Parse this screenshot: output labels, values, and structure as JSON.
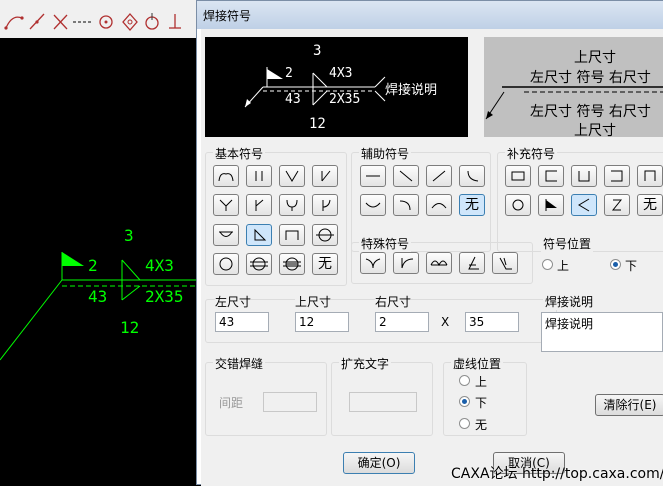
{
  "cad": {
    "toolbar_icons": [
      "arc-tool-icon",
      "line-tool-icon",
      "cross-tool-icon",
      "dash-line-icon",
      "circle-tool-icon",
      "polygon-tool-icon",
      "rotate-tool-icon",
      "anchor-tool-icon"
    ],
    "symbol": {
      "top": "3",
      "left": "43",
      "upper_left": "2",
      "upper_right": "4X3",
      "lower_right": "2X35",
      "bottom": "12"
    }
  },
  "dialog": {
    "title": "焊接符号",
    "preview": {
      "top": "3",
      "upper_left": "2",
      "upper_right": "4X3",
      "lower_left": "43",
      "lower_right": "2X35",
      "bottom": "12",
      "note": "焊接说明"
    },
    "legend": {
      "top": "上尺寸",
      "row1": "左尺寸 符号 右尺寸",
      "row2": "左尺寸 符号 右尺寸",
      "bottom": "上尺寸"
    },
    "groups": {
      "basic": "基本符号",
      "aux": "辅助符号",
      "supp": "补充符号",
      "special": "特殊符号",
      "pos": "符号位置",
      "stagger": "交错焊缝",
      "ext": "扩充文字",
      "dash": "虚线位置",
      "note": "焊接说明"
    },
    "wu": "无",
    "pos_options": [
      "上",
      "下"
    ],
    "dash_options": [
      "上",
      "下",
      "无"
    ],
    "fields": {
      "left_label": "左尺寸",
      "left_value": "43",
      "top_label": "上尺寸",
      "top_value": "12",
      "right_label": "右尺寸",
      "right_value1": "2",
      "x": "X",
      "right_value2": "35",
      "note_value": "焊接说明",
      "spacing_label": "间距"
    },
    "buttons": {
      "clear": "清除行(E)",
      "ok": "确定(O)",
      "cancel": "取消(C)"
    },
    "watermark": "CAXA论坛  http://top.caxa.com/"
  },
  "colors": {
    "cad_bg": "#000000",
    "cad_green": "#00ff00",
    "dialog_bg": "#f0f0f0"
  }
}
